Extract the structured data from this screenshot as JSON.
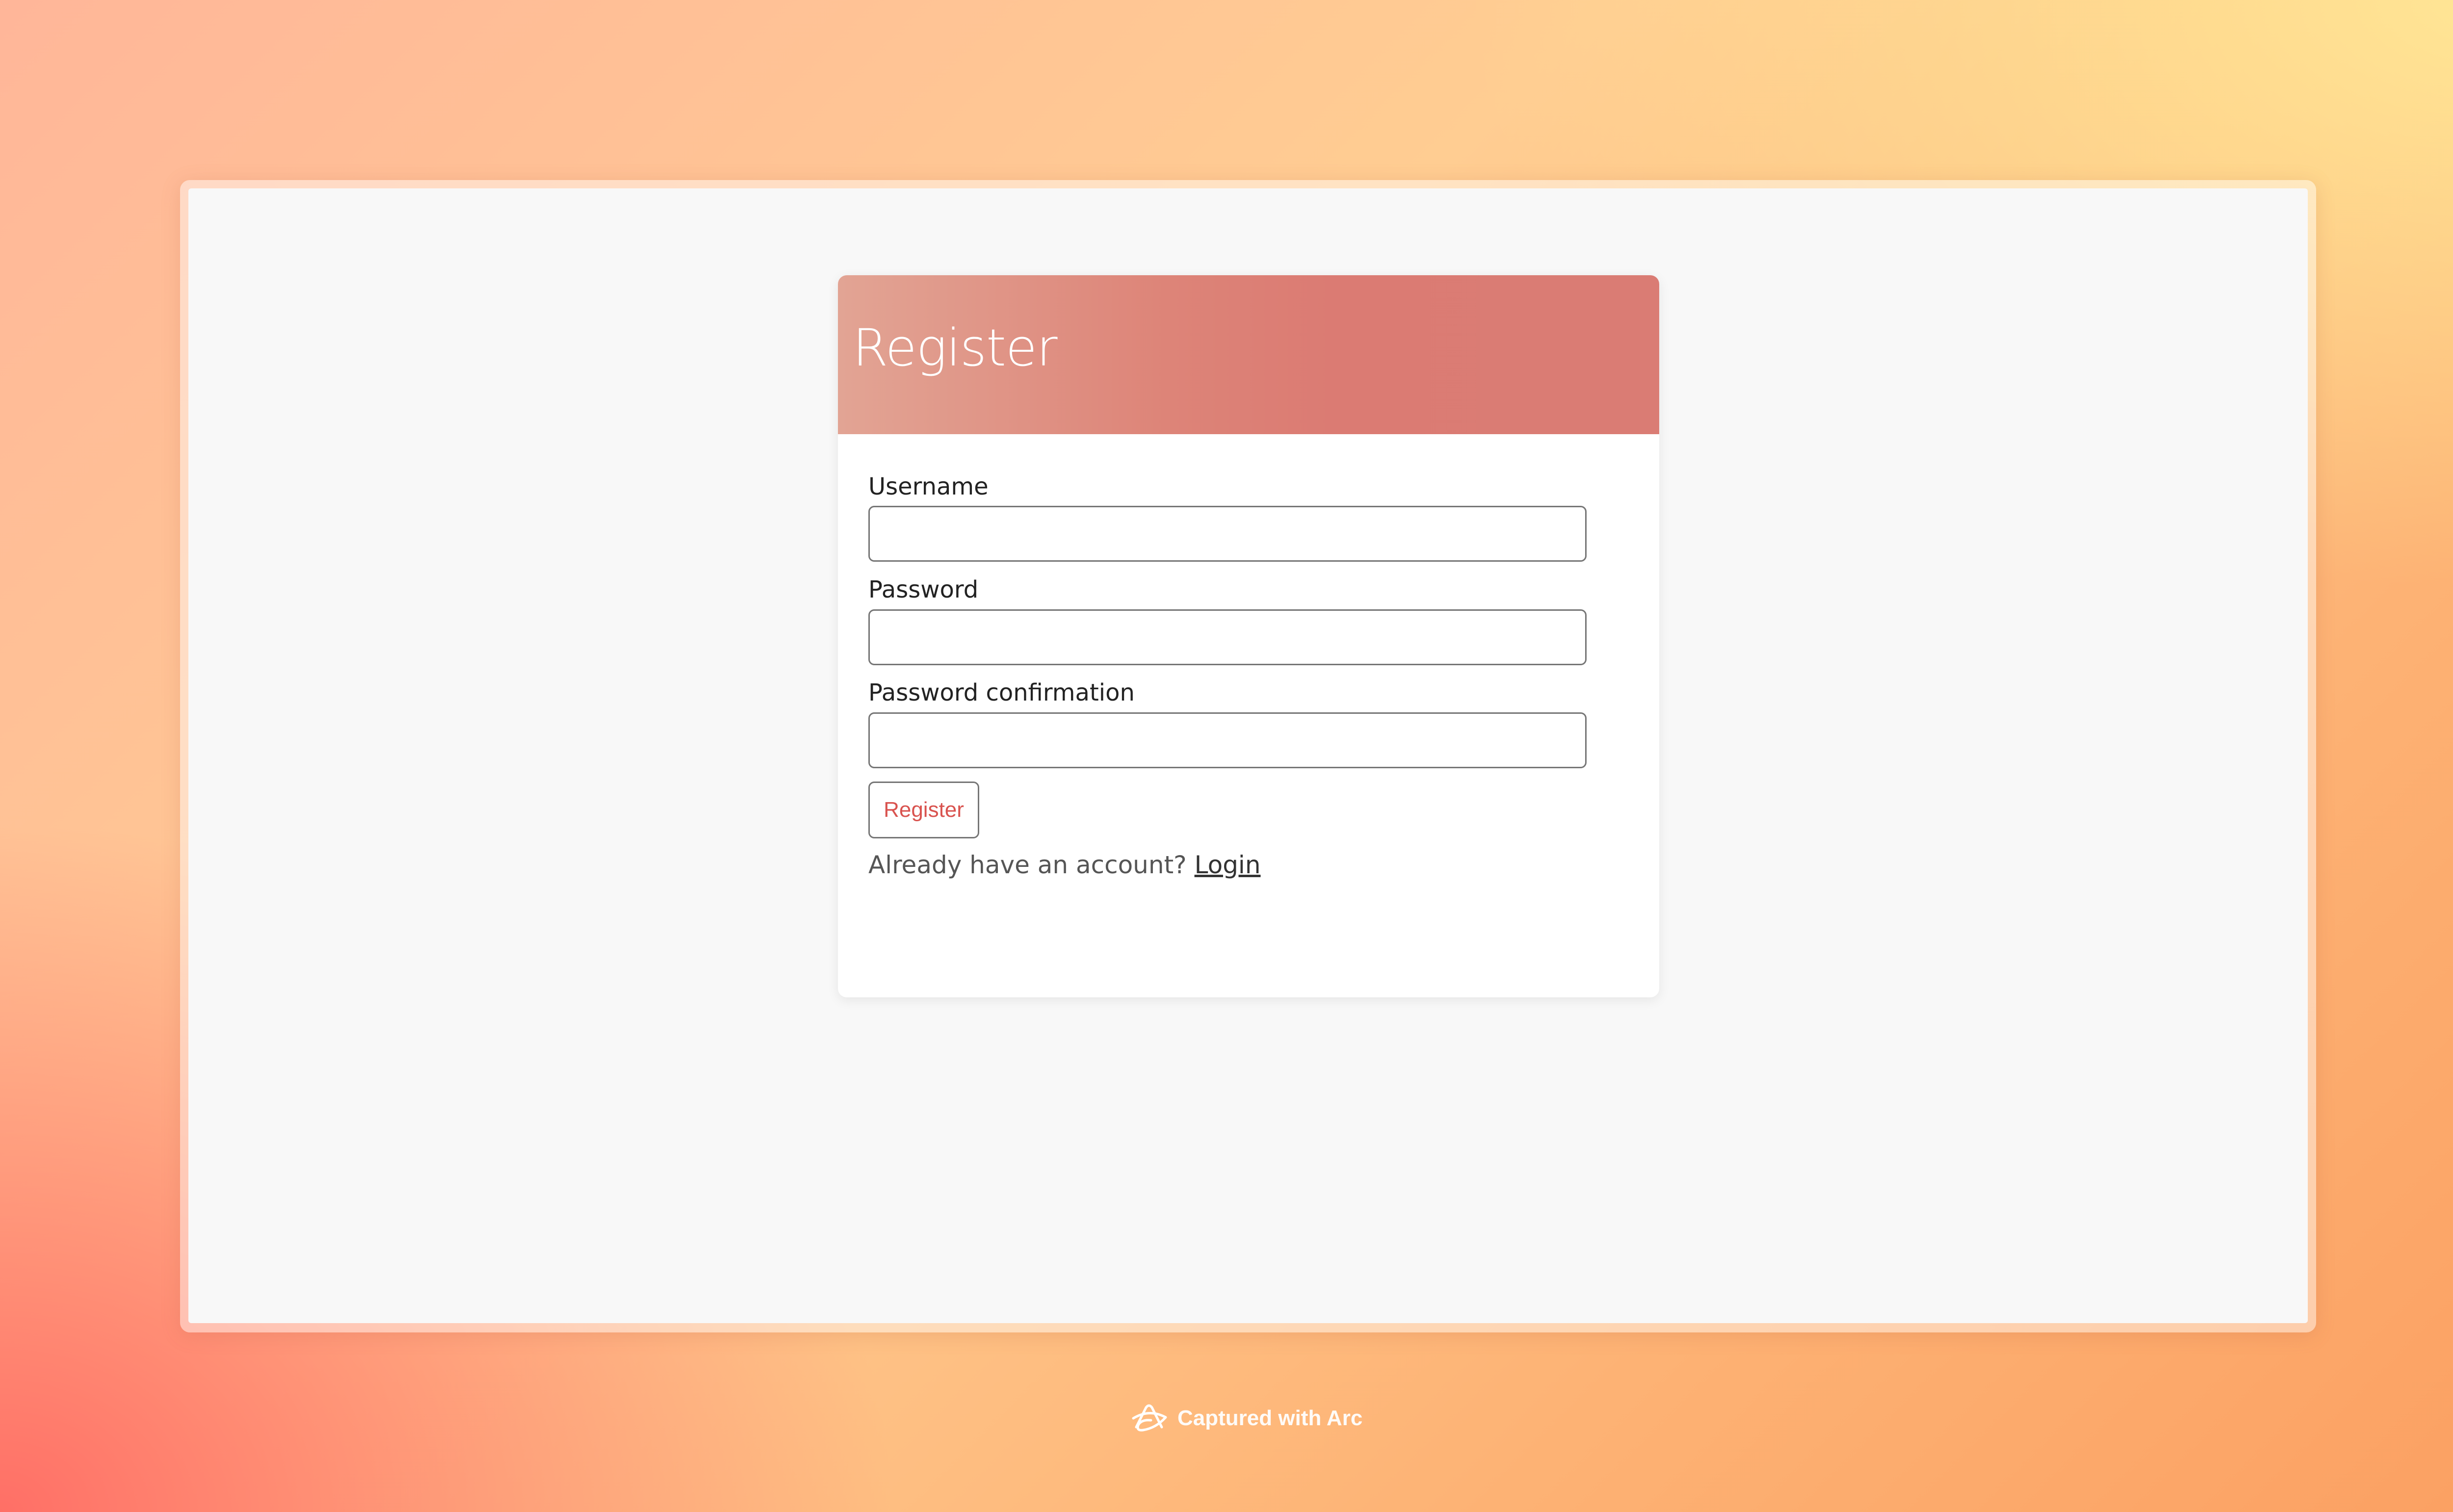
{
  "form": {
    "title": "Register",
    "fields": [
      {
        "label": "Username",
        "value": ""
      },
      {
        "label": "Password",
        "value": ""
      },
      {
        "label": "Password confirmation",
        "value": ""
      }
    ],
    "submit_label": "Register",
    "account_prompt": "Already have an account?",
    "login_link": "Login"
  },
  "capture_badge": {
    "text": "Captured with Arc",
    "icon": "arc-logo-icon"
  },
  "colors": {
    "header_start": "#e2a494",
    "header_end": "#da7c74",
    "submit_text": "#d9534f",
    "page_background": "#f8f8f8"
  }
}
